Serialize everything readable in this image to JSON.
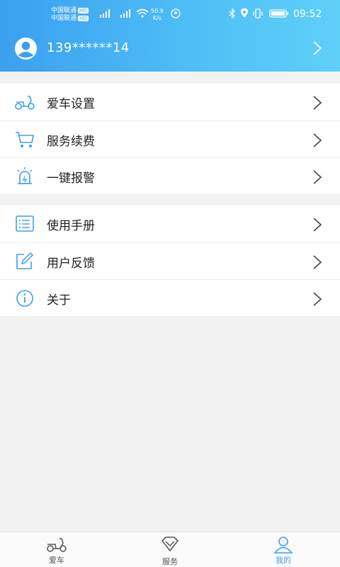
{
  "status_bar": {
    "carrier1": "中国联通",
    "carrier2": "中国联通",
    "hd_badge": "HD",
    "net_speed_value": "50.9",
    "net_speed_unit": "K/s",
    "time": "09:52",
    "icons": [
      "signal-icon",
      "wifi-icon",
      "bluetooth-icon",
      "location-icon",
      "vibrate-icon",
      "battery-icon"
    ]
  },
  "user": {
    "phone": "139******14"
  },
  "menu_group_1": [
    {
      "label": "爱车设置",
      "icon": "scooter-icon"
    },
    {
      "label": "服务续费",
      "icon": "cart-icon"
    },
    {
      "label": "一键报警",
      "icon": "alarm-icon"
    }
  ],
  "menu_group_2": [
    {
      "label": "使用手册",
      "icon": "list-icon"
    },
    {
      "label": "用户反馈",
      "icon": "edit-icon"
    },
    {
      "label": "关于",
      "icon": "info-icon"
    }
  ],
  "tabbar": {
    "tabs": [
      {
        "label": "爱车",
        "icon": "scooter-icon",
        "active": false
      },
      {
        "label": "服务",
        "icon": "diamond-icon",
        "active": false
      },
      {
        "label": "我的",
        "icon": "user-icon",
        "active": true
      }
    ]
  },
  "colors": {
    "accent": "#3aa0f0",
    "icon_blue": "#3aa0f0",
    "background": "#f2f2f2"
  }
}
